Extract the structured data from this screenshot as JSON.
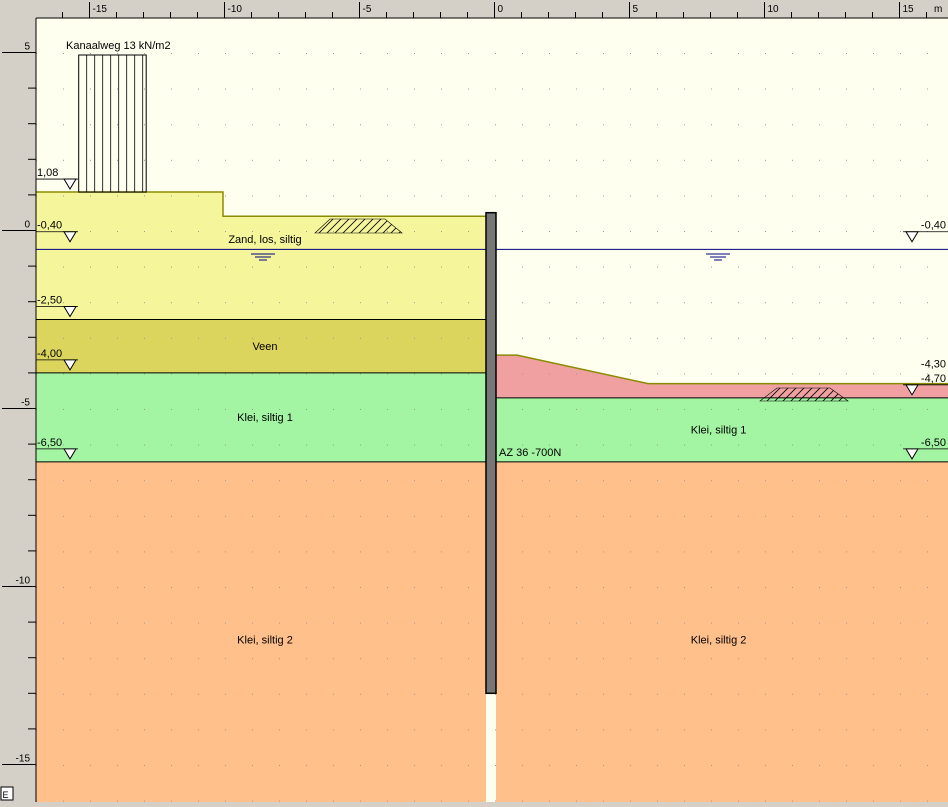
{
  "ruler": {
    "unit": "m",
    "corner": "E",
    "x_ticks": [
      {
        "v": -15,
        "label": "-15"
      },
      {
        "v": -10,
        "label": "-10"
      },
      {
        "v": -5,
        "label": "-5"
      },
      {
        "v": 0,
        "label": "0"
      },
      {
        "v": 5,
        "label": "5"
      },
      {
        "v": 10,
        "label": "10"
      },
      {
        "v": 15,
        "label": "15"
      }
    ],
    "y_ticks": [
      {
        "v": 5,
        "label": "5"
      },
      {
        "v": 0,
        "label": "0"
      },
      {
        "v": -5,
        "label": "-5"
      },
      {
        "v": -10,
        "label": "-10"
      },
      {
        "v": -15,
        "label": "-15"
      }
    ]
  },
  "load": {
    "label": "Kanaalweg 13 kN/m2",
    "x_from": -15.4,
    "x_to": -12.9
  },
  "levels_left": [
    {
      "label": "1,08",
      "value": 1.08
    },
    {
      "label": "-0,40",
      "value": -0.4
    },
    {
      "label": "-2,50",
      "value": -2.5
    },
    {
      "label": "-4,00",
      "value": -4.0
    },
    {
      "label": "-6,50",
      "value": -6.5
    }
  ],
  "levels_right": [
    {
      "label": "-0,40",
      "value": -0.4
    },
    {
      "label": "-4,30",
      "value": -4.3
    },
    {
      "label": "-4,70",
      "value": -4.7
    },
    {
      "label": "-6,50",
      "value": -6.5
    }
  ],
  "soil_labels": [
    {
      "text": "Zand, los, siltig",
      "x": -8.5,
      "y": -0.35
    },
    {
      "text": "Veen",
      "x": -8.5,
      "y": -3.35
    },
    {
      "text": "Klei, siltig 1",
      "x": -8.5,
      "y": -5.35
    },
    {
      "text": "Klei, siltig 1",
      "x": 8.3,
      "y": -5.7
    },
    {
      "text": "Klei, siltig 2",
      "x": -8.5,
      "y": -11.6
    },
    {
      "text": "Klei, siltig 2",
      "x": 8.3,
      "y": -11.6
    }
  ],
  "sheet_pile": {
    "label": "AZ 36 -700N",
    "top": 0.5,
    "bottom": -13.0
  },
  "colors": {
    "air": "#fffff0",
    "sand": "#f5f59c",
    "peat": "#dcd55d",
    "clay1": "#a3f5a3",
    "clay2": "#ffc08c",
    "red": "#f0a0a0",
    "water": "#000080",
    "surface": "#8b8b00",
    "pile": "#777777"
  }
}
